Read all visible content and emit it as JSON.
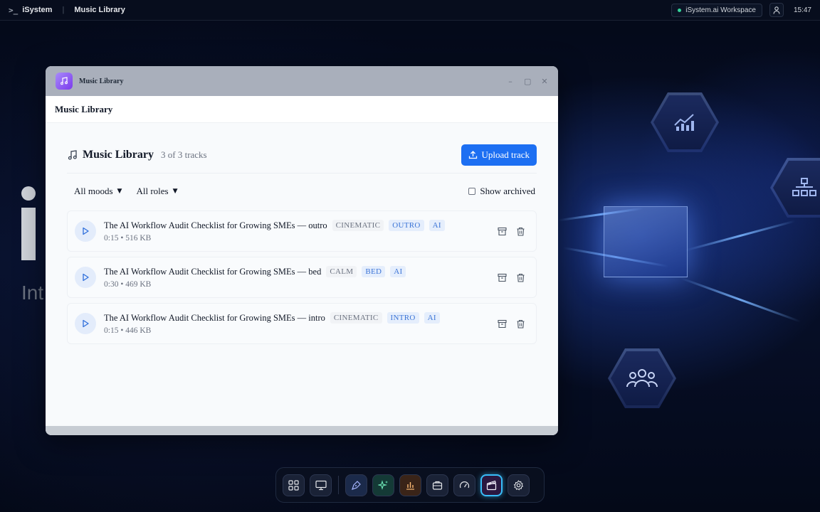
{
  "topbar": {
    "brand": "iSystem",
    "crumb": "Music Library",
    "workspace": "iSystem.ai Workspace",
    "clock": "15:47"
  },
  "background": {
    "partial_text": "Int"
  },
  "window": {
    "title": "Music Library",
    "header": "Music Library",
    "controls": {
      "minimize": "–",
      "maximize": "▢",
      "close": "✕"
    }
  },
  "library": {
    "heading": "Music Library",
    "count": "3 of 3 tracks",
    "upload_label": "Upload track",
    "filters": {
      "mood": "All moods",
      "role": "All roles",
      "archived_label": "Show archived"
    },
    "tracks": [
      {
        "title": "The AI Workflow Audit Checklist for Growing SMEs — outro",
        "mood": "CINEMATIC",
        "role": "OUTRO",
        "ai": "AI",
        "meta": "0:15 • 516 KB"
      },
      {
        "title": "The AI Workflow Audit Checklist for Growing SMEs — bed",
        "mood": "CALM",
        "role": "BED",
        "ai": "AI",
        "meta": "0:30 • 469 KB"
      },
      {
        "title": "The AI Workflow Audit Checklist for Growing SMEs — intro",
        "mood": "CINEMATIC",
        "role": "INTRO",
        "ai": "AI",
        "meta": "0:15 • 446 KB"
      }
    ]
  },
  "dock": {
    "items": [
      "grid-icon",
      "monitor-icon",
      "pen-icon",
      "sparkles-icon",
      "bar-chart-icon",
      "briefcase-icon",
      "gauge-icon",
      "clapperboard-icon",
      "settings-icon"
    ],
    "active": "clapperboard-icon"
  },
  "colors": {
    "accent": "#1d6ff2",
    "tag_role_bg": "#e5eefc",
    "tag_role_text": "#3b74d6",
    "dock_active": "#38bdf8"
  }
}
